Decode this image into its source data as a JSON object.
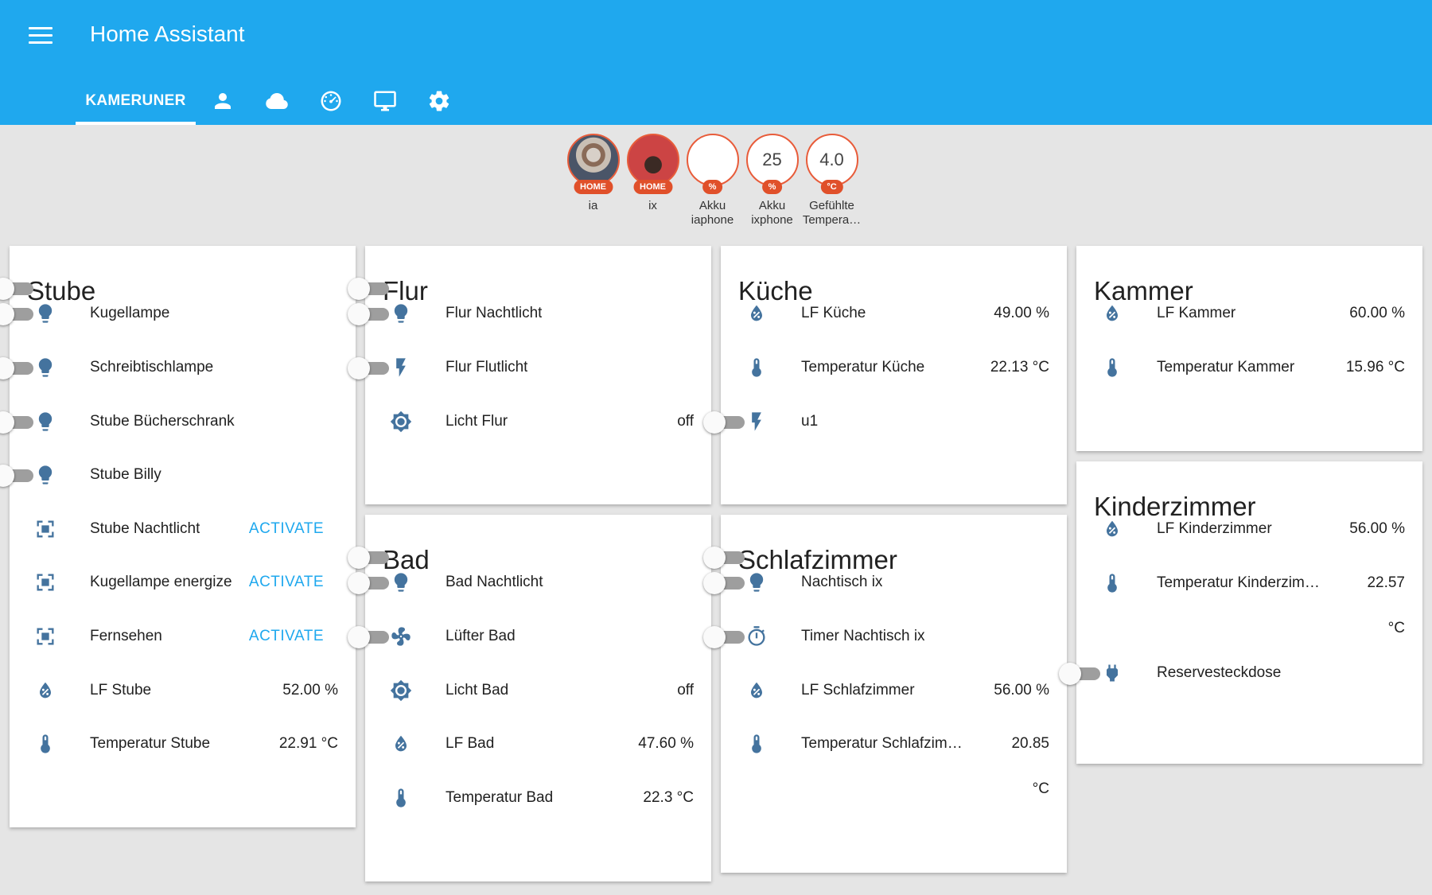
{
  "header": {
    "title": "Home Assistant",
    "tabs": [
      {
        "label": "KAMERUNER",
        "selected": true
      },
      {
        "icon": "account-icon"
      },
      {
        "icon": "cloud-icon"
      },
      {
        "icon": "gauge-icon"
      },
      {
        "icon": "monitor-icon"
      },
      {
        "icon": "settings-icon"
      }
    ]
  },
  "badges": [
    {
      "type": "photo",
      "unit": "HOME",
      "label": "ia"
    },
    {
      "type": "photo",
      "unit": "HOME",
      "label": "ix"
    },
    {
      "type": "value",
      "value": "",
      "unit": "%",
      "label": "Akku iaphone"
    },
    {
      "type": "value",
      "value": "25",
      "unit": "%",
      "label": "Akku ixphone"
    },
    {
      "type": "value",
      "value": "4.0",
      "unit": "°C",
      "label": "Gefühlte Tempera…"
    }
  ],
  "cards": {
    "stube": {
      "title": "Stube",
      "rows": [
        {
          "icon": "bulb-icon",
          "name": "Kugellampe",
          "state": "off"
        },
        {
          "icon": "bulb-icon",
          "name": "Schreibtischlampe",
          "state": "off"
        },
        {
          "icon": "bulb-icon",
          "name": "Stube Bücherschrank",
          "state": "off"
        },
        {
          "icon": "bulb-icon",
          "name": "Stube Billy",
          "state": "off"
        },
        {
          "icon": "scene-icon",
          "name": "Stube Nachtlicht",
          "action": "ACTIVATE"
        },
        {
          "icon": "scene-icon",
          "name": "Kugellampe energize",
          "action": "ACTIVATE"
        },
        {
          "icon": "scene-icon",
          "name": "Fernsehen",
          "action": "ACTIVATE"
        },
        {
          "icon": "humidity-icon",
          "name": "LF Stube",
          "value": "52.00 %"
        },
        {
          "icon": "thermometer-icon",
          "name": "Temperatur Stube",
          "value": "22.91 °C"
        }
      ]
    },
    "flur": {
      "title": "Flur",
      "rows": [
        {
          "icon": "bulb-icon",
          "name": "Flur Nachtlicht",
          "state": "off"
        },
        {
          "icon": "flash-icon",
          "name": "Flur Flutlicht",
          "state": "off"
        },
        {
          "icon": "brightness-icon",
          "name": "Licht Flur",
          "value": "off"
        }
      ]
    },
    "bad": {
      "title": "Bad",
      "rows": [
        {
          "icon": "bulb-icon",
          "name": "Bad Nachtlicht",
          "state": "off"
        },
        {
          "icon": "fan-icon",
          "name": "Lüfter Bad",
          "state": "off"
        },
        {
          "icon": "brightness-icon",
          "name": "Licht Bad",
          "value": "off"
        },
        {
          "icon": "humidity-icon",
          "name": "LF Bad",
          "value": "47.60 %"
        },
        {
          "icon": "thermometer-icon",
          "name": "Temperatur Bad",
          "value": "22.3 °C"
        }
      ]
    },
    "kueche": {
      "title": "Küche",
      "rows": [
        {
          "icon": "humidity-icon",
          "name": "LF Küche",
          "value": "49.00 %"
        },
        {
          "icon": "thermometer-icon",
          "name": "Temperatur Küche",
          "value": "22.13 °C"
        },
        {
          "icon": "flash-icon",
          "name": "u1",
          "state": "off"
        }
      ]
    },
    "schlafzimmer": {
      "title": "Schlafzimmer",
      "rows": [
        {
          "icon": "bulb-icon",
          "name": "Nachtisch ix",
          "state": "off"
        },
        {
          "icon": "timer-icon",
          "name": "Timer Nachtisch ix",
          "state": "off"
        },
        {
          "icon": "humidity-icon",
          "name": "LF Schlafzimmer",
          "value": "56.00 %"
        },
        {
          "icon": "thermometer-icon",
          "name": "Temperatur Schlafzim…",
          "value": "20.85",
          "unit": "°C"
        }
      ]
    },
    "kammer": {
      "title": "Kammer",
      "rows": [
        {
          "icon": "humidity-icon",
          "name": "LF Kammer",
          "value": "60.00 %"
        },
        {
          "icon": "thermometer-icon",
          "name": "Temperatur Kammer",
          "value": "15.96 °C"
        }
      ]
    },
    "kinderzimmer": {
      "title": "Kinderzimmer",
      "rows": [
        {
          "icon": "humidity-icon",
          "name": "LF Kinderzimmer",
          "value": "56.00 %"
        },
        {
          "icon": "thermometer-icon",
          "name": "Temperatur Kinderzim…",
          "value": "22.57",
          "unit": "°C"
        },
        {
          "icon": "power-plug-icon",
          "name": "Reservesteckdose",
          "state": "off"
        }
      ]
    }
  },
  "colors": {
    "header": "#1fa8ee",
    "icon": "#44739e",
    "badge": "#e0502a",
    "action": "#1fa8ee",
    "background": "#e5e5e5"
  }
}
